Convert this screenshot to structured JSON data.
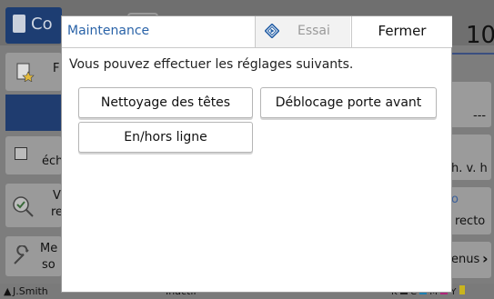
{
  "background": {
    "tab_label": "Co",
    "count": "10",
    "left_labels": [
      "F",
      "éch",
      "V",
      "re",
      "Me",
      "so"
    ],
    "right_labels": [
      "---",
      "h. v. h",
      "o",
      "recto",
      "enus"
    ],
    "status_user": "J.Smith",
    "status_mid": "Inactif",
    "status_colors": [
      "K",
      "C",
      "M",
      "Y"
    ]
  },
  "dialog": {
    "title": "Maintenance",
    "essai_label": "Essai",
    "close_label": "Fermer",
    "message": "Vous pouvez effectuer les réglages suivants.",
    "buttons": {
      "head_cleaning": "Nettoyage des têtes",
      "front_door_release": "Déblocage porte avant",
      "online_offline": "En/hors ligne"
    }
  },
  "colors": {
    "accent": "#2a63a8",
    "essai_icon": "#2a63a8"
  }
}
